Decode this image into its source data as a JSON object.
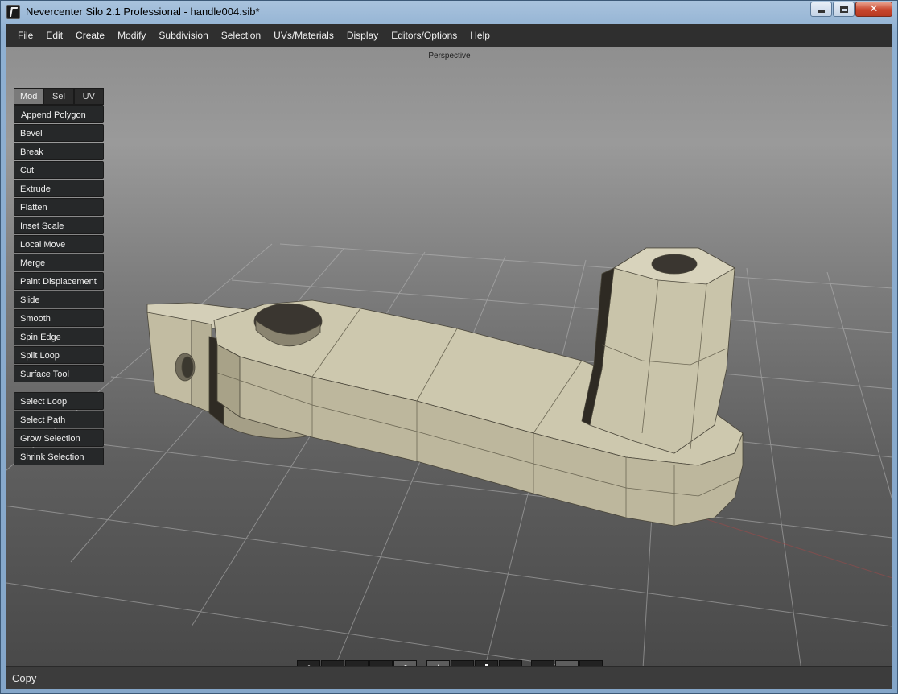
{
  "window": {
    "title": "Nevercenter Silo 2.1 Professional - handle004.sib*",
    "minimize": "",
    "maximize": "",
    "close": "✕"
  },
  "menubar": [
    "File",
    "Edit",
    "Create",
    "Modify",
    "Subdivision",
    "Selection",
    "UVs/Materials",
    "Display",
    "Editors/Options",
    "Help"
  ],
  "viewport": {
    "label": "Perspective"
  },
  "toolpanel": {
    "tabs": [
      {
        "label": "Mod",
        "active": true
      },
      {
        "label": "Sel",
        "active": false
      },
      {
        "label": "UV",
        "active": false
      }
    ],
    "tools": [
      "Append Polygon",
      "Bevel",
      "Break",
      "Cut",
      "Extrude",
      "Flatten",
      "Inset Scale",
      "Local Move",
      "Merge",
      "Paint Displacement",
      "Slide",
      "Smooth",
      "Spin Edge",
      "Split Loop",
      "Surface Tool"
    ],
    "selection_tools": [
      "Select Loop",
      "Select Path",
      "Grow Selection",
      "Shrink Selection"
    ]
  },
  "bottom_toolbar": {
    "selection_mode_icons": [
      "vertex-mode-icon",
      "edge-mode-icon",
      "face-mode-icon",
      "object-mode-icon",
      "all-mode-icon"
    ],
    "manipulator_icons": [
      "move-manipulator-icon",
      "rotate-manipulator-icon",
      "scale-manipulator-icon",
      "universal-manipulator-icon"
    ],
    "select_style_icons": [
      "lasso-select-icon",
      "rectangle-select-icon",
      "paint-select-icon"
    ],
    "active": [
      "rectangle-select-icon"
    ]
  },
  "status": {
    "text": "Copy"
  },
  "colors": {
    "model_face": "#c5bfa5",
    "model_shadow": "#2f2b24",
    "menu_bg": "#2f2f2f",
    "panel_button": "#262829"
  }
}
